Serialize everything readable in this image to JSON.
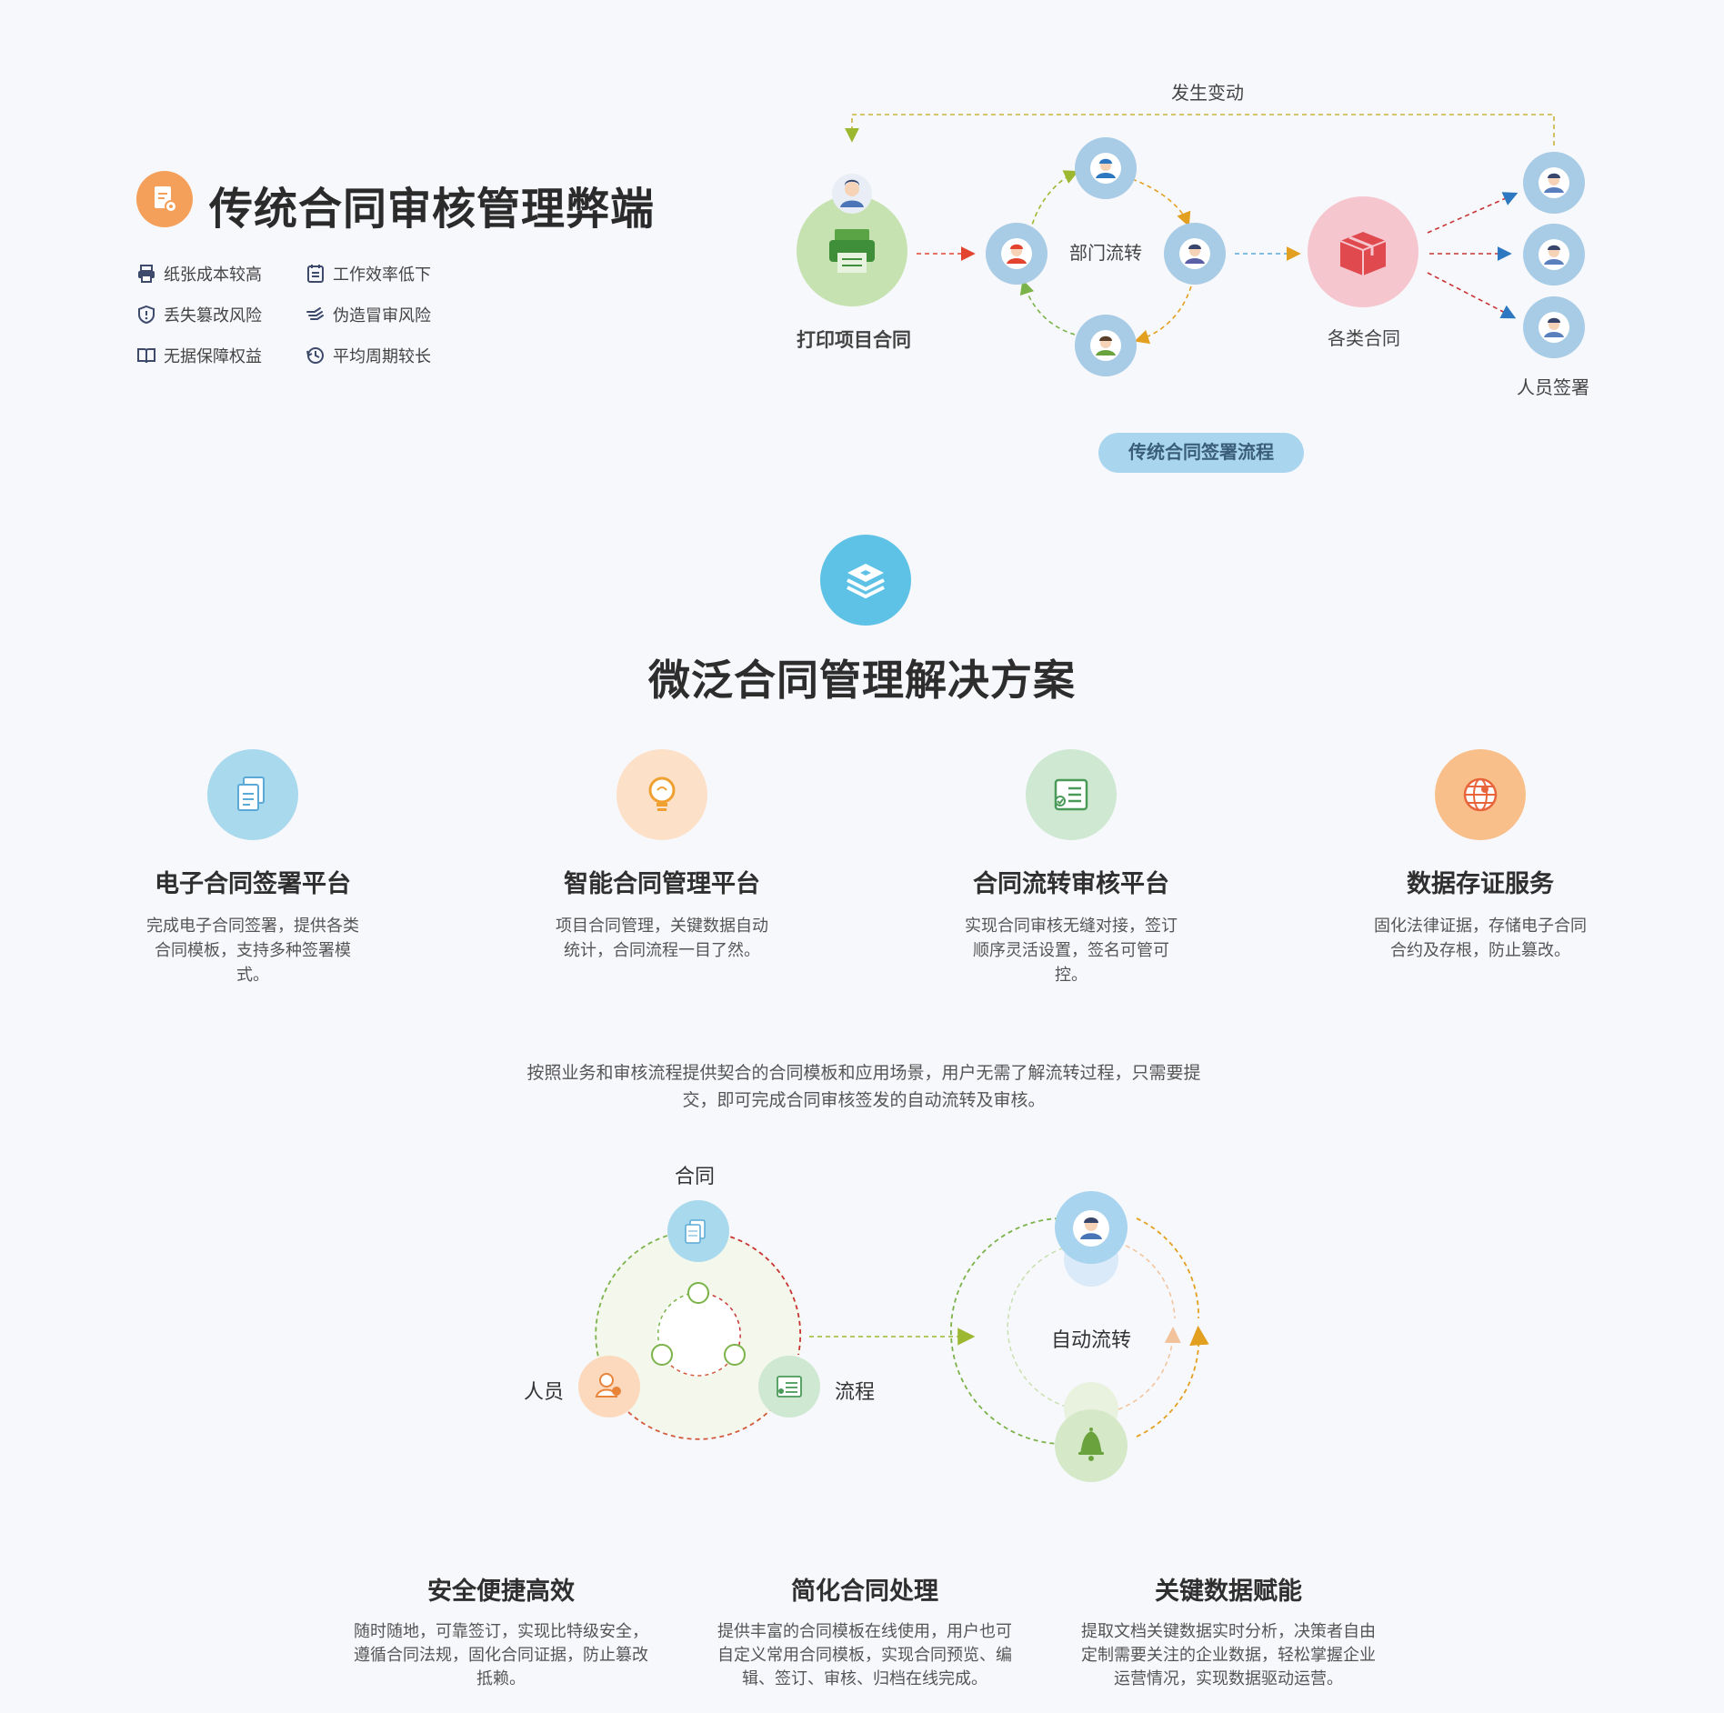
{
  "top": {
    "title": "传统合同审核管理弊端",
    "problems": [
      {
        "label": "纸张成本较高",
        "icon": "printer-icon"
      },
      {
        "label": "工作效率低下",
        "icon": "calendar-icon"
      },
      {
        "label": "丢失篡改风险",
        "icon": "shield-icon"
      },
      {
        "label": "伪造冒审风险",
        "icon": "hand-icon"
      },
      {
        "label": "无据保障权益",
        "icon": "book-icon"
      },
      {
        "label": "平均周期较长",
        "icon": "clock-icon"
      }
    ],
    "flow": {
      "change_label": "发生变动",
      "print_label": "打印项目合同",
      "dept_label": "部门流转",
      "contracts_label": "各类合同",
      "sign_label": "人员签署",
      "pill_label": "传统合同签署流程"
    }
  },
  "solution": {
    "title": "微泛合同管理解决方案",
    "features": [
      {
        "title": "电子合同签署平台",
        "desc": "完成电子合同签署，提供各类合同模板，支持多种签署模式。",
        "icon": "documents-icon",
        "color": "#a8d9ec"
      },
      {
        "title": "智能合同管理平台",
        "desc": "项目合同管理，关键数据自动统计，合同流程一目了然。",
        "icon": "lightbulb-icon",
        "color": "#fde0c8"
      },
      {
        "title": "合同流转审核平台",
        "desc": "实现合同审核无缝对接，签订顺序灵活设置，签名可管可控。",
        "icon": "checklist-icon",
        "color": "#cfe8d2"
      },
      {
        "title": "数据存证服务",
        "desc": "固化法律证据，存储电子合同合约及存根，防止篡改。",
        "icon": "globe-icon",
        "color": "#f9bf8a"
      }
    ]
  },
  "process": {
    "intro": "按照业务和审核流程提供契合的合同模板和应用场景，用户无需了解流转过程，只需要提交，即可完成合同审核签发的自动流转及审核。",
    "left_labels": {
      "contract": "合同",
      "person": "人员",
      "flow": "流程"
    },
    "right_label": "自动流转"
  },
  "benefits": [
    {
      "title": "安全便捷高效",
      "desc": "随时随地，可靠签订，实现比特级安全，遵循合同法规，固化合同证据，防止篡改抵赖。"
    },
    {
      "title": "简化合同处理",
      "desc": "提供丰富的合同模板在线使用，用户也可自定义常用合同模板，实现合同预览、编辑、签订、审核、归档在线完成。"
    },
    {
      "title": "关键数据赋能",
      "desc": "提取文档关键数据实时分析，决策者自由定制需要关注的企业数据，轻松掌握企业运营情况，实现数据驱动运营。"
    }
  ]
}
